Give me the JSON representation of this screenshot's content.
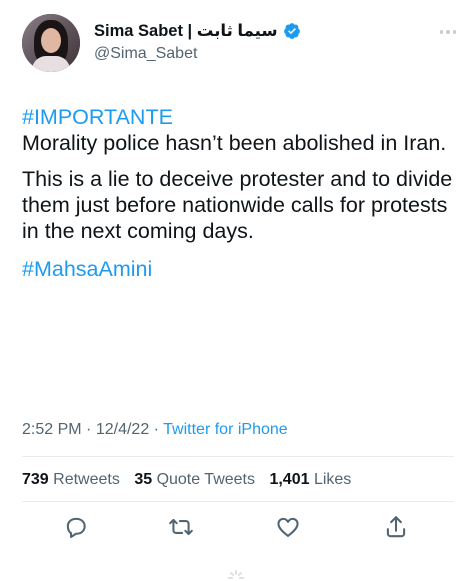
{
  "tweet": {
    "author": {
      "display_name": "Sima Sabet | سیما ثابت",
      "handle": "@Sima_Sabet",
      "verified": true
    },
    "hashtag_top": "#IMPORTANTE",
    "paragraph_1": "Morality police hasn’t been abolished in Iran.",
    "paragraph_2": "This is a lie to deceive protester and to divide them just before nationwide calls for protests in the next coming days.",
    "hashtag_bottom": "#MahsaAmini",
    "time": "2:52 PM",
    "separator": "·",
    "date": "12/4/22",
    "source": "Twitter for iPhone"
  },
  "stats": {
    "retweets_count": "739",
    "retweets_label": "Retweets",
    "quotes_count": "35",
    "quotes_label": "Quote Tweets",
    "likes_count": "1,401",
    "likes_label": "Likes"
  },
  "icons": {
    "verified": "verified-badge-icon",
    "more": "more-options-icon",
    "reply": "reply-icon",
    "retweet": "retweet-icon",
    "like": "like-icon",
    "share": "share-icon"
  },
  "colors": {
    "accent": "#1d9bf0",
    "text_primary": "#0f1419",
    "text_secondary": "#536471",
    "divider": "#e6ecf0"
  }
}
